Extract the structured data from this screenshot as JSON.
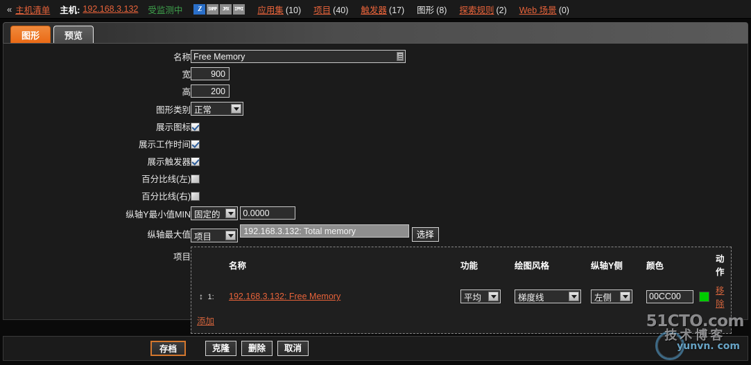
{
  "header": {
    "chevron": "«",
    "host_list_link": "主机清单",
    "host_label": "主机:",
    "host_value": "192.168.3.132",
    "status": "受监测中",
    "icons": [
      {
        "name": "zabbix-agent-icon",
        "text": "Z"
      },
      {
        "name": "snmp-icon",
        "text": "SNMP"
      },
      {
        "name": "jmx-icon",
        "text": "JMX"
      },
      {
        "name": "ipmi-icon",
        "text": "IPMI"
      }
    ],
    "nav": [
      {
        "label": "应用集",
        "count": "(10)",
        "link": true
      },
      {
        "label": "项目",
        "count": "(40)",
        "link": true
      },
      {
        "label": "触发器",
        "count": "(17)",
        "link": true
      },
      {
        "label": "图形",
        "count": "(8)",
        "link": false
      },
      {
        "label": "探索规则",
        "count": "(2)",
        "link": true
      },
      {
        "label": "Web 场景",
        "count": "(0)",
        "link": true
      }
    ]
  },
  "tabs": [
    {
      "label": "图形",
      "active": true
    },
    {
      "label": "预览",
      "active": false
    }
  ],
  "form": {
    "name": {
      "label": "名称",
      "value": "Free Memory"
    },
    "width": {
      "label": "宽",
      "value": "900"
    },
    "height": {
      "label": "高",
      "value": "200"
    },
    "graph_type": {
      "label": "图形类别",
      "value": "正常"
    },
    "show_legend": {
      "label": "展示图标",
      "checked": true
    },
    "show_working_time": {
      "label": "展示工作时间",
      "checked": true
    },
    "show_triggers": {
      "label": "展示触发器",
      "checked": true
    },
    "percentile_left": {
      "label": "百分比线(左)",
      "checked": false
    },
    "percentile_right": {
      "label": "百分比线(右)",
      "checked": false
    },
    "ymin": {
      "label": "纵轴Y最小值MIN",
      "type": "固定的",
      "value": "0.0000"
    },
    "ymax": {
      "label": "纵轴最大值",
      "type": "项目",
      "value": "192.168.3.132: Total memory",
      "button": "选择"
    },
    "items_label": "项目"
  },
  "items_table": {
    "columns": [
      "名称",
      "功能",
      "绘图风格",
      "纵轴Y侧",
      "颜色",
      "动作"
    ],
    "rows": [
      {
        "index": "1:",
        "drag": "↕",
        "name": "192.168.3.132: Free Memory",
        "function": "平均",
        "draw_style": "梯度线",
        "y_side": "左侧",
        "color": "00CC00",
        "color_hex": "#00CC00",
        "action": "移除"
      }
    ],
    "add_link": "添加"
  },
  "footer": {
    "buttons": [
      {
        "label": "存档",
        "primary": true
      },
      {
        "label": "克隆",
        "primary": false
      },
      {
        "label": "删除",
        "primary": false
      },
      {
        "label": "取消",
        "primary": false
      }
    ]
  },
  "watermarks": {
    "line1": "51CTO.com",
    "line2": "技术博客",
    "site": "yunvn. com"
  },
  "colors": {
    "accent_link": "#e8633a",
    "tab_active": "#ea6a15",
    "status_green": "#3fa34d",
    "series_green": "#00CC00"
  }
}
